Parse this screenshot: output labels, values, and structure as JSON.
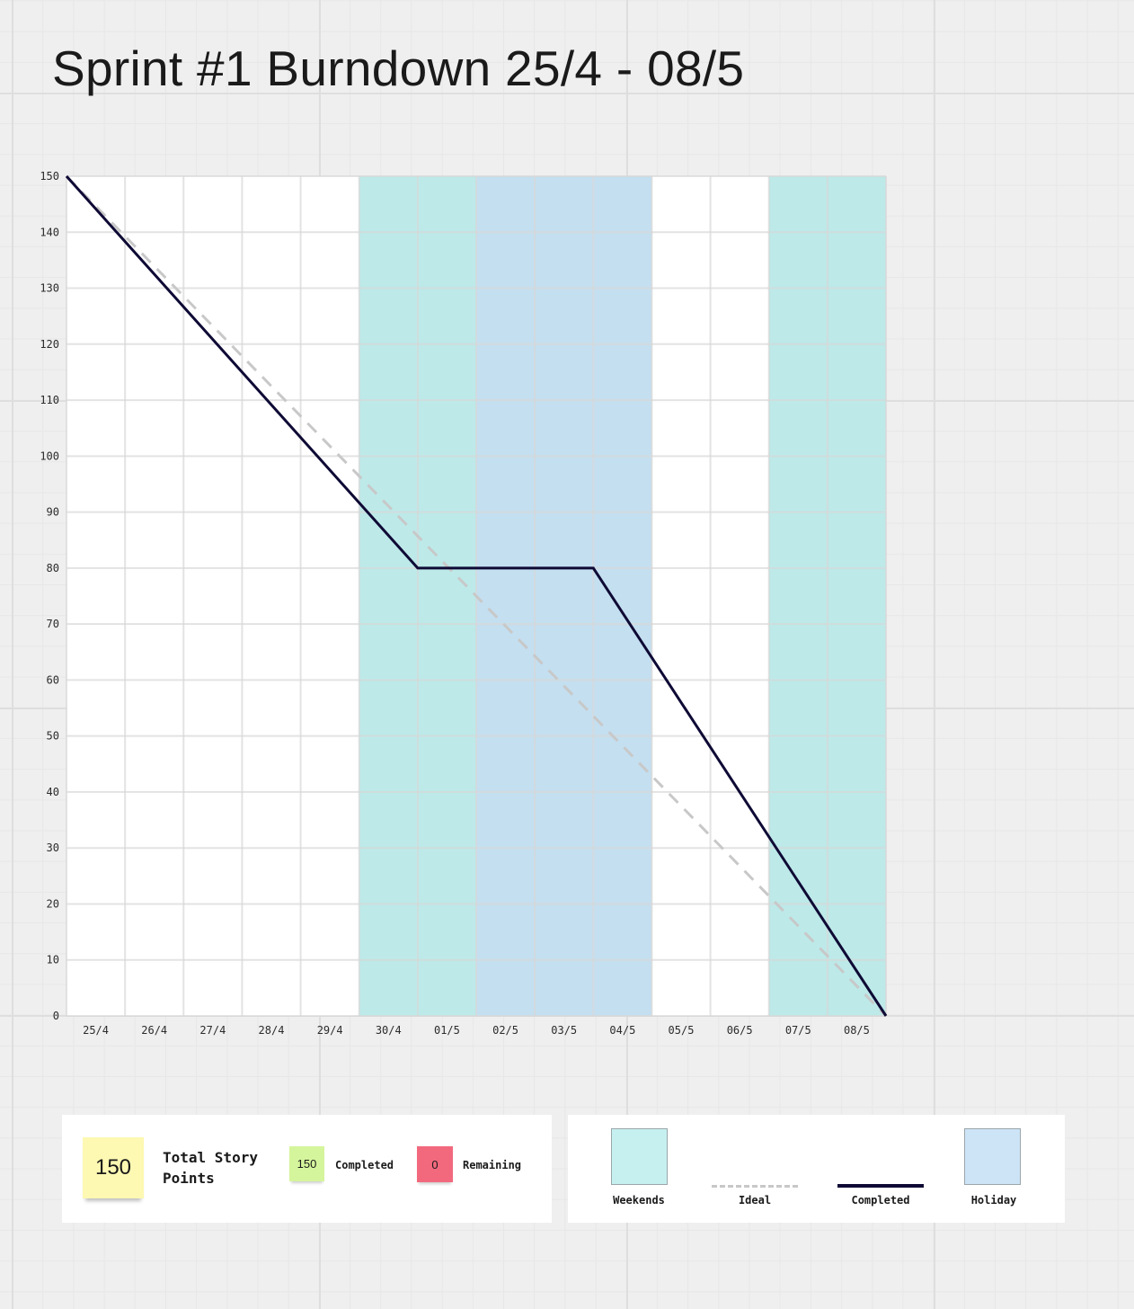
{
  "title": "Sprint #1 Burndown 25/4 - 08/5",
  "chart_data": {
    "type": "line",
    "x": [
      "25/4",
      "26/4",
      "27/4",
      "28/4",
      "29/4",
      "30/4",
      "01/5",
      "02/5",
      "03/5",
      "04/5",
      "05/5",
      "06/5",
      "07/5",
      "08/5"
    ],
    "y_ticks": [
      0,
      10,
      20,
      30,
      40,
      50,
      60,
      70,
      80,
      90,
      100,
      110,
      120,
      130,
      140,
      150
    ],
    "ylim": [
      0,
      150
    ],
    "grid": true,
    "shaded_ranges": [
      {
        "category": "Weekends",
        "from": "30/4",
        "to": "01/5",
        "color": "#bde9e9"
      },
      {
        "category": "Holiday",
        "from": "02/5",
        "to": "04/5",
        "color": "#c4dff0"
      },
      {
        "category": "Weekends",
        "from": "07/5",
        "to": "08/5",
        "color": "#bde9e9"
      }
    ],
    "series": [
      {
        "name": "Ideal",
        "style": "dashed",
        "color": "#c8c8c8",
        "points": [
          [
            "25/4",
            150
          ],
          [
            "08/5",
            0
          ]
        ]
      },
      {
        "name": "Completed",
        "style": "solid",
        "color": "#0e0a35",
        "points": [
          [
            "25/4",
            150
          ],
          [
            "01/5",
            80
          ],
          [
            "04/5",
            80
          ],
          [
            "08/5",
            0
          ]
        ]
      }
    ]
  },
  "summary": {
    "total_value": "150",
    "total_label": "Total Story\nPoints",
    "completed_value": "150",
    "completed_label": "Completed",
    "remaining_value": "0",
    "remaining_label": "Remaining"
  },
  "legend": {
    "weekends": "Weekends",
    "ideal": "Ideal",
    "completed": "Completed",
    "holiday": "Holiday"
  }
}
